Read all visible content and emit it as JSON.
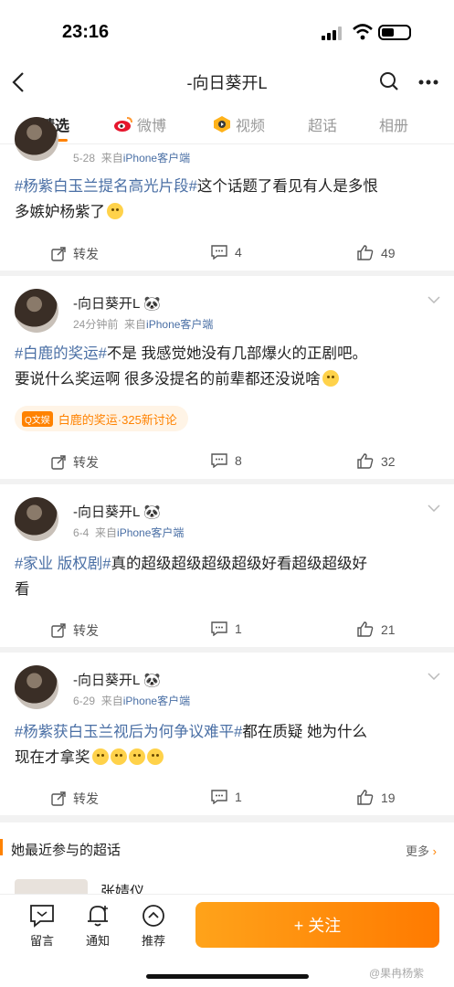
{
  "status_bar": {
    "time": "23:16"
  },
  "nav": {
    "title": "-向日葵开L"
  },
  "tabs": [
    {
      "label": "精选"
    },
    {
      "label": "微博"
    },
    {
      "label": "视频"
    },
    {
      "label": "超话"
    },
    {
      "label": "相册"
    }
  ],
  "posts": [
    {
      "date": "5-28",
      "source_prefix": "来自",
      "source": "iPhone客户端",
      "topic": "#杨紫白玉兰提名高光片段#",
      "text1": "这个话题了看见有人是多恨",
      "text2": "多嫉妒杨紫了",
      "repost_label": "转发",
      "comments": "4",
      "likes": "49"
    },
    {
      "username": "-向日葵开L",
      "date": "24分钟前",
      "source_prefix": "来自",
      "source": "iPhone客户端",
      "topic": "#白鹿的奖运#",
      "text1": "不是 我感觉她没有几部爆火的正剧吧。",
      "text2": "要说什么奖运啊 很多没提名的前辈都还没说啥",
      "pill_tag": "Q文娱",
      "pill_text": "白鹿的奖运·325新讨论",
      "repost_label": "转发",
      "comments": "8",
      "likes": "32"
    },
    {
      "username": "-向日葵开L",
      "date": "6-4",
      "source_prefix": "来自",
      "source": "iPhone客户端",
      "topic": "#家业 版权剧#",
      "text1": "真的超级超级超级超级好看超级超级好",
      "text2": "看",
      "repost_label": "转发",
      "comments": "1",
      "likes": "21"
    },
    {
      "username": "-向日葵开L",
      "date": "6-29",
      "source_prefix": "来自",
      "source": "iPhone客户端",
      "topic": "#杨紫获白玉兰视后为何争议难平#",
      "text1": "都在质疑 她为什么",
      "text2": "现在才拿奖",
      "repost_label": "转发",
      "comments": "1",
      "likes": "19"
    }
  ],
  "chaohua": {
    "title": "她最近参与的超话",
    "more": "更多",
    "item_name": "张婧仪"
  },
  "bottom": {
    "message": "留言",
    "notify": "通知",
    "recommend": "推荐",
    "follow": "+ 关注"
  },
  "watermark": "@果冉杨紫"
}
